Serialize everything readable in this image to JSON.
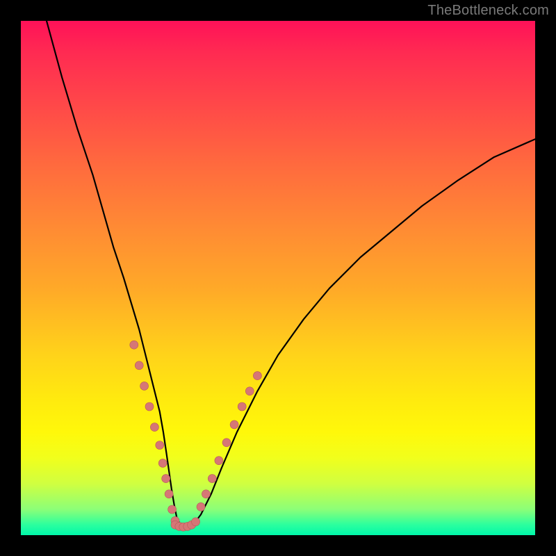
{
  "watermark": "TheBottleneck.com",
  "chart_data": {
    "type": "line",
    "title": "",
    "xlabel": "",
    "ylabel": "",
    "xlim": [
      0,
      100
    ],
    "ylim": [
      0,
      100
    ],
    "legend": false,
    "grid": false,
    "colors": {
      "curve": "#000000",
      "markers": "#d67676"
    },
    "curve": {
      "x": [
        5,
        8,
        11,
        14,
        16,
        18,
        20,
        21.5,
        23,
        24,
        25,
        26,
        27,
        27.7,
        28.3,
        28.8,
        29.3,
        29.8,
        30.3,
        31,
        32,
        33.5,
        35,
        37,
        39,
        42,
        46,
        50,
        55,
        60,
        66,
        72,
        78,
        85,
        92,
        100
      ],
      "y": [
        100,
        89,
        79,
        70,
        63,
        56,
        50,
        45,
        40,
        36,
        32,
        28,
        24,
        20,
        16,
        12.5,
        9,
        6,
        3.5,
        2,
        1.5,
        2,
        4,
        8,
        13,
        20,
        28,
        35,
        42,
        48,
        54,
        59,
        64,
        69,
        73.5,
        77
      ]
    },
    "series": [
      {
        "name": "markers-left",
        "x": [
          22.0,
          23.0,
          24.0,
          25.0,
          26.0,
          27.0,
          27.6,
          28.2,
          28.8,
          29.4,
          30.0
        ],
        "y": [
          37.0,
          33.0,
          29.0,
          25.0,
          21.0,
          17.5,
          14.0,
          11.0,
          8.0,
          5.0,
          2.8
        ]
      },
      {
        "name": "markers-bottom",
        "x": [
          30.0,
          30.8,
          31.6,
          32.4,
          33.2,
          34.0
        ],
        "y": [
          2.0,
          1.7,
          1.6,
          1.7,
          2.0,
          2.6
        ]
      },
      {
        "name": "markers-right",
        "x": [
          35.0,
          36.0,
          37.2,
          38.5,
          40.0,
          41.5,
          43.0,
          44.5,
          46.0
        ],
        "y": [
          5.5,
          8.0,
          11.0,
          14.5,
          18.0,
          21.5,
          25.0,
          28.0,
          31.0
        ]
      }
    ]
  }
}
